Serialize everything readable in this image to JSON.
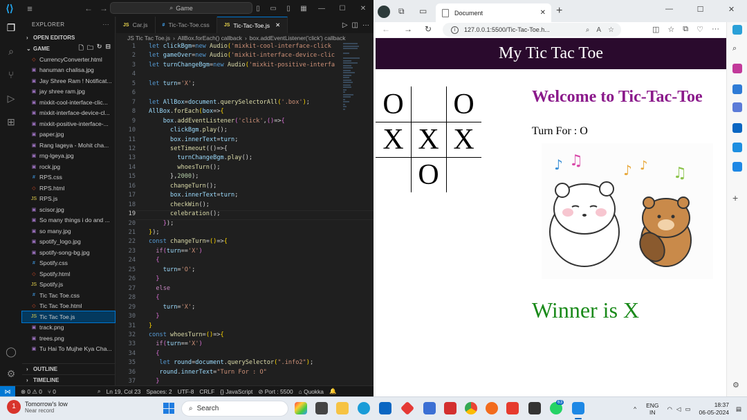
{
  "vscode": {
    "search": "Game",
    "explorer": {
      "title": "EXPLORER",
      "open_editors": "OPEN EDITORS",
      "folder": "GAME",
      "files": [
        {
          "name": "CurrencyConverter.html",
          "type": "html"
        },
        {
          "name": "hanuman chalisa.jpg",
          "type": "img"
        },
        {
          "name": "Jay Shree Ram ! Notificat...",
          "type": "img"
        },
        {
          "name": "jay shree ram.jpg",
          "type": "img"
        },
        {
          "name": "mixkit-cool-interface-clic...",
          "type": "img"
        },
        {
          "name": "mixkit-interface-device-cl...",
          "type": "img"
        },
        {
          "name": "mixkit-positive-interface-...",
          "type": "img"
        },
        {
          "name": "paper.jpg",
          "type": "img"
        },
        {
          "name": "Rang lageya - Mohit cha...",
          "type": "img"
        },
        {
          "name": "rng-lgeya.jpg",
          "type": "img"
        },
        {
          "name": "rock.jpg",
          "type": "img"
        },
        {
          "name": "RPS.css",
          "type": "css"
        },
        {
          "name": "RPS.html",
          "type": "html"
        },
        {
          "name": "RPS.js",
          "type": "js"
        },
        {
          "name": "scisor.jpg",
          "type": "img"
        },
        {
          "name": "So many things i do and ...",
          "type": "img"
        },
        {
          "name": "so many.jpg",
          "type": "img"
        },
        {
          "name": "spotify_logo.jpg",
          "type": "img"
        },
        {
          "name": "spotify-song-bg.jpg",
          "type": "img"
        },
        {
          "name": "Spotify.css",
          "type": "css"
        },
        {
          "name": "Spotify.html",
          "type": "html"
        },
        {
          "name": "Spotify.js",
          "type": "js"
        },
        {
          "name": "Tic Tac Toe.css",
          "type": "css"
        },
        {
          "name": "Tic Tac Toe.html",
          "type": "html"
        },
        {
          "name": "Tic Tac Toe.js",
          "type": "js"
        },
        {
          "name": "track.png",
          "type": "img"
        },
        {
          "name": "trees.png",
          "type": "img"
        },
        {
          "name": "Tu Hai To Mujhe Kya Cha...",
          "type": "img"
        }
      ],
      "outline": "OUTLINE",
      "timeline": "TIMELINE"
    },
    "tabs": [
      {
        "label": "Car.js",
        "icon": "JS"
      },
      {
        "label": "Tic-Tac-Toe.css",
        "icon": "#"
      },
      {
        "label": "Tic-Tac-Toe.js",
        "icon": "JS"
      }
    ],
    "breadcrumbs": [
      "JS Tic Tac Toe.js",
      "›",
      "AllBox.forEach() callback",
      "›",
      "box.addEventListener('click') callback"
    ],
    "code": [
      [
        [
          "k",
          "let "
        ],
        [
          "v",
          "clickBgm"
        ],
        [
          "",
          "="
        ],
        [
          "k",
          "new "
        ],
        [
          "f",
          "Audio"
        ],
        [
          "y",
          "("
        ],
        [
          "s",
          "'mixkit-cool-interface-click"
        ]
      ],
      [
        [
          "k",
          "let "
        ],
        [
          "v",
          "gameOver"
        ],
        [
          "",
          "="
        ],
        [
          "k",
          "new "
        ],
        [
          "f",
          "Audio"
        ],
        [
          "y",
          "("
        ],
        [
          "s",
          "'mixkit-interface-device-clic"
        ]
      ],
      [
        [
          "k",
          "let "
        ],
        [
          "v",
          "turnChangeBgm"
        ],
        [
          "",
          "="
        ],
        [
          "k",
          "new "
        ],
        [
          "f",
          "Audio"
        ],
        [
          "y",
          "("
        ],
        [
          "s",
          "'mixkit-positive-interfa"
        ]
      ],
      [],
      [
        [
          "k",
          "let "
        ],
        [
          "v",
          "turn"
        ],
        [
          "",
          "="
        ],
        [
          "s",
          "'X'"
        ],
        [
          "",
          ";"
        ]
      ],
      [],
      [
        [
          "k",
          "let "
        ],
        [
          "v",
          "AllBox"
        ],
        [
          "",
          "="
        ],
        [
          "v",
          "document"
        ],
        [
          "",
          "."
        ],
        [
          "f",
          "querySelectorAll"
        ],
        [
          "y",
          "("
        ],
        [
          "s",
          "'.box'"
        ],
        [
          "y",
          ")"
        ],
        [
          "",
          ";"
        ]
      ],
      [
        [
          "v",
          "AllBox"
        ],
        [
          "",
          "."
        ],
        [
          "f",
          "forEach"
        ],
        [
          "y",
          "("
        ],
        [
          "v",
          "box"
        ],
        [
          "",
          "=>"
        ],
        [
          "y",
          "{"
        ]
      ],
      [
        [
          "",
          "    "
        ],
        [
          "v",
          "box"
        ],
        [
          "",
          "."
        ],
        [
          "f",
          "addEventListener"
        ],
        [
          "p",
          "("
        ],
        [
          "s",
          "'click'"
        ],
        [
          "",
          ","
        ],
        [
          "p",
          "("
        ],
        [
          "p",
          ")"
        ],
        [
          "",
          "=>"
        ],
        [
          "p",
          "{"
        ]
      ],
      [
        [
          "",
          "      "
        ],
        [
          "v",
          "clickBgm"
        ],
        [
          "",
          "."
        ],
        [
          "f",
          "play"
        ],
        [
          "",
          "();"
        ]
      ],
      [
        [
          "",
          "      "
        ],
        [
          "v",
          "box"
        ],
        [
          "",
          "."
        ],
        [
          "v",
          "innerText"
        ],
        [
          "",
          "="
        ],
        [
          "v",
          "turn"
        ],
        [
          "",
          ";"
        ]
      ],
      [
        [
          "",
          "      "
        ],
        [
          "f",
          "setTimeout"
        ],
        [
          "",
          "(()=>{"
        ]
      ],
      [
        [
          "",
          "        "
        ],
        [
          "v",
          "turnChangeBgm"
        ],
        [
          "",
          "."
        ],
        [
          "f",
          "play"
        ],
        [
          "",
          "();"
        ]
      ],
      [
        [
          "",
          "        "
        ],
        [
          "f",
          "whoesTurn"
        ],
        [
          "",
          "();"
        ]
      ],
      [
        [
          "",
          "      "
        ],
        [
          "",
          "},"
        ],
        [
          "n",
          "2000"
        ],
        [
          "",
          ");"
        ]
      ],
      [
        [
          "",
          "      "
        ],
        [
          "f",
          "changeTurn"
        ],
        [
          "",
          "();"
        ]
      ],
      [
        [
          "",
          "      "
        ],
        [
          "v",
          "box"
        ],
        [
          "",
          "."
        ],
        [
          "v",
          "innerText"
        ],
        [
          "",
          "="
        ],
        [
          "v",
          "turn"
        ],
        [
          "",
          ";"
        ]
      ],
      [
        [
          "",
          "      "
        ],
        [
          "f",
          "checkWin"
        ],
        [
          "",
          "();"
        ]
      ],
      [
        [
          "",
          "      "
        ],
        [
          "f",
          "celebration"
        ],
        [
          "",
          "();"
        ]
      ],
      [
        [
          "",
          "    "
        ],
        [
          "p",
          "}"
        ],
        [
          "",
          ");"
        ]
      ],
      [
        [
          "y",
          "}"
        ],
        [
          "",
          ");"
        ]
      ],
      [
        [
          "k",
          "const "
        ],
        [
          "f",
          "changeTurn"
        ],
        [
          "",
          "="
        ],
        [
          "y",
          "()"
        ],
        [
          "",
          "=>"
        ],
        [
          "y",
          "{"
        ]
      ],
      [
        [
          "",
          "  "
        ],
        [
          "c",
          "if"
        ],
        [
          "p",
          "("
        ],
        [
          "v",
          "turn"
        ],
        [
          "",
          "=="
        ],
        [
          "s",
          "'X'"
        ],
        [
          "p",
          ")"
        ]
      ],
      [
        [
          "",
          "  "
        ],
        [
          "p",
          "{"
        ]
      ],
      [
        [
          "",
          "    "
        ],
        [
          "v",
          "turn"
        ],
        [
          "",
          "="
        ],
        [
          "s",
          "'O'"
        ],
        [
          "",
          ";"
        ]
      ],
      [
        [
          "",
          "  "
        ],
        [
          "p",
          "}"
        ]
      ],
      [
        [
          "",
          "  "
        ],
        [
          "c",
          "else"
        ]
      ],
      [
        [
          "",
          "  "
        ],
        [
          "p",
          "{"
        ]
      ],
      [
        [
          "",
          "    "
        ],
        [
          "v",
          "turn"
        ],
        [
          "",
          "="
        ],
        [
          "s",
          "'X'"
        ],
        [
          "",
          ";"
        ]
      ],
      [
        [
          "",
          "  "
        ],
        [
          "p",
          "}"
        ]
      ],
      [
        [
          "y",
          "}"
        ]
      ],
      [
        [
          "k",
          "const "
        ],
        [
          "f",
          "whoesTurn"
        ],
        [
          "",
          "="
        ],
        [
          "y",
          "()"
        ],
        [
          "",
          "=>"
        ],
        [
          "y",
          "{"
        ]
      ],
      [
        [
          "",
          "  "
        ],
        [
          "c",
          "if"
        ],
        [
          "p",
          "("
        ],
        [
          "v",
          "turn"
        ],
        [
          "",
          "=="
        ],
        [
          "s",
          "'X'"
        ],
        [
          "p",
          ")"
        ]
      ],
      [
        [
          "",
          "  "
        ],
        [
          "p",
          "{"
        ]
      ],
      [
        [
          "",
          "   "
        ],
        [
          "k",
          "let "
        ],
        [
          "v",
          "round"
        ],
        [
          "",
          "="
        ],
        [
          "v",
          "document"
        ],
        [
          "",
          "."
        ],
        [
          "f",
          "querySelector"
        ],
        [
          "y",
          "("
        ],
        [
          "s",
          "\".info2\""
        ],
        [
          "y",
          ")"
        ],
        [
          "",
          ";"
        ]
      ],
      [
        [
          "",
          "   "
        ],
        [
          "v",
          "round"
        ],
        [
          "",
          "."
        ],
        [
          "v",
          "innerText"
        ],
        [
          "",
          "="
        ],
        [
          "s",
          "\"Turn For : O\""
        ]
      ],
      [
        [
          "",
          "  "
        ],
        [
          "p",
          "}"
        ]
      ]
    ],
    "first_line_number": 1,
    "current_line": 19,
    "status": {
      "errors": "0",
      "warnings": "0",
      "ports": "0",
      "position": "Ln 19, Col 23",
      "spaces": "Spaces: 2",
      "encoding": "UTF-8",
      "eol": "CRLF",
      "language": "JavaScript",
      "port": "Port : 5500",
      "ext": "Quokka"
    }
  },
  "browser": {
    "tab_title": "Document",
    "address": "127.0.0.1:5500/Tic-Tac-Toe.h...",
    "page": {
      "header": "My Tic Tac Toe",
      "board": [
        "O",
        "",
        "O",
        "X",
        "X",
        "X",
        "",
        "O",
        ""
      ],
      "welcome": "Welcome to Tic-Tac-Toe",
      "turn": "Turn For : O",
      "winner": "Winner is X"
    }
  },
  "taskbar": {
    "weather_title": "Tomorrow's low",
    "weather_sub": "Near record",
    "search": "Search",
    "lang": "ENG",
    "lang_sub": "IN",
    "time": "18:37",
    "date": "06-05-2024",
    "badge": "63"
  }
}
